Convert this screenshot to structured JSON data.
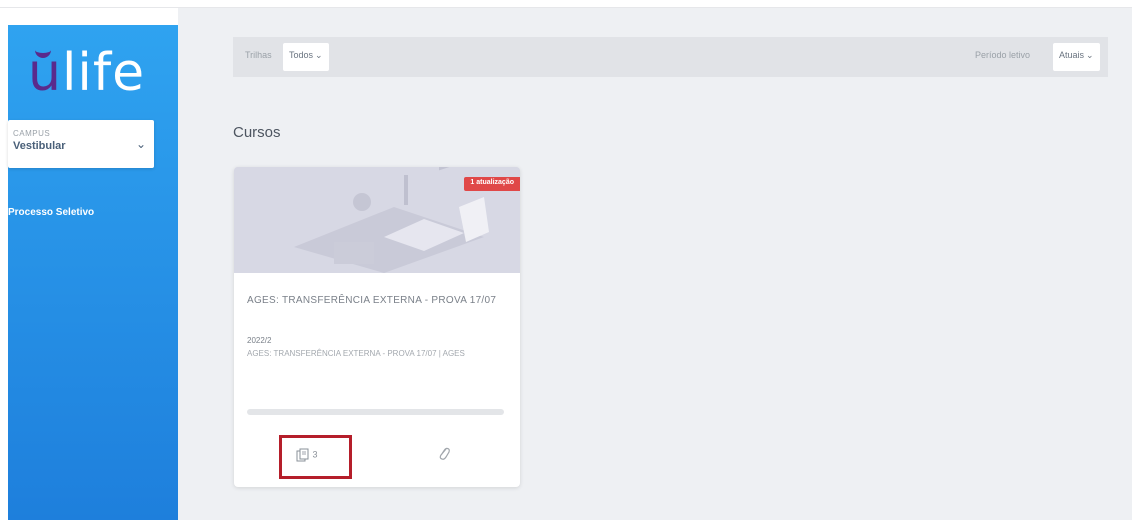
{
  "sidebar": {
    "logo_text": "life",
    "logo_accent": "u",
    "campus_caption": "CAMPUS",
    "campus_value": "Vestibular",
    "nav_item": "Processo Seletivo"
  },
  "filters": {
    "trilhas_label": "Trilhas",
    "trilhas_value": "Todos",
    "periodo_label": "Período letivo",
    "periodo_value": "Atuais"
  },
  "section_title": "Cursos",
  "course_card": {
    "badge": "1 atualização",
    "title": "AGES: TRANSFERÊNCIA EXTERNA - PROVA 17/07",
    "period": "2022/2",
    "description": "AGES: TRANSFERÊNCIA EXTERNA - PROVA 17/07 | AGES",
    "progress": 0,
    "documents_count": "3",
    "icons": [
      "documents-icon",
      "paperclip-icon"
    ]
  },
  "colors": {
    "sidebar_top": "#2fa3f0",
    "sidebar_bottom": "#1e7fdc",
    "logo_accent": "#5a2a8c",
    "badge": "#e04848",
    "highlight": "#b51e2a"
  }
}
